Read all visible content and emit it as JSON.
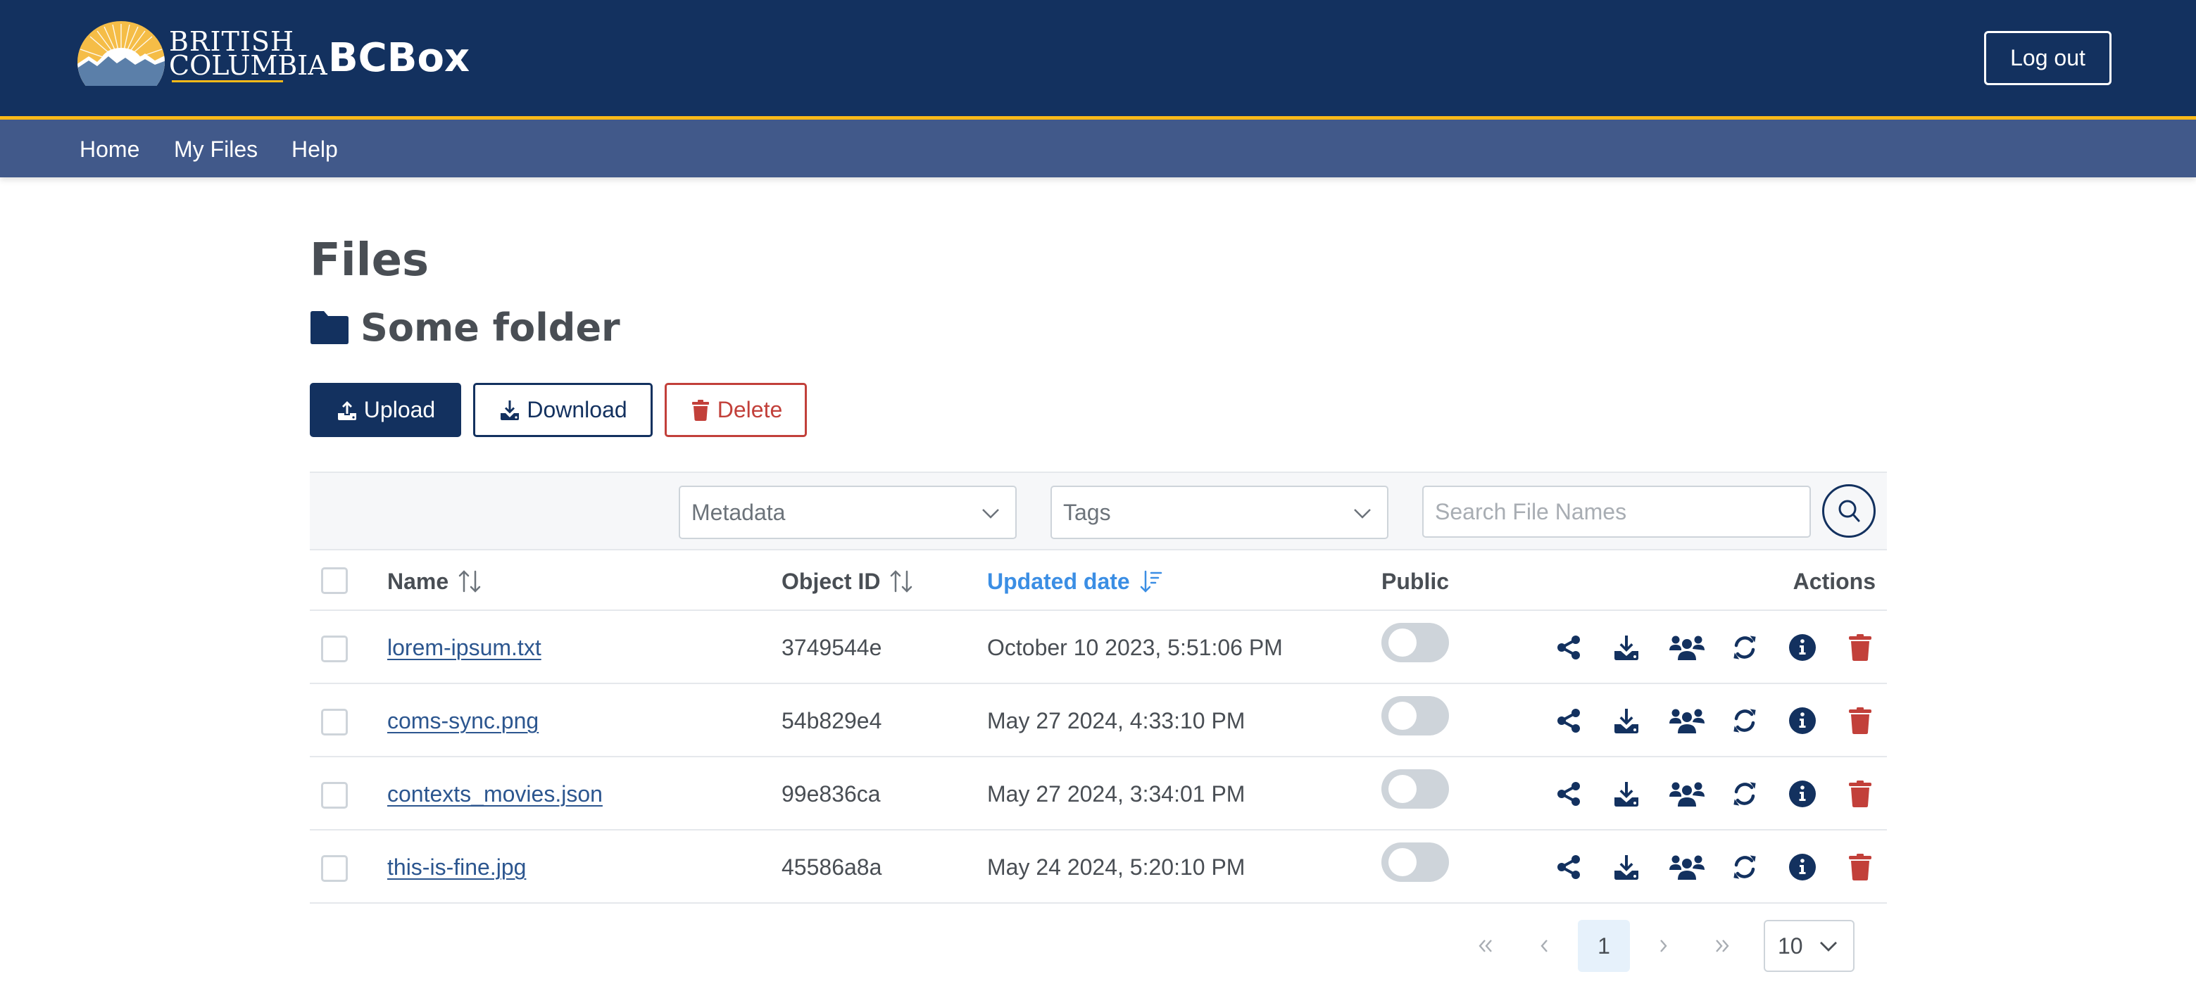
{
  "header": {
    "logo_line1": "BRITISH",
    "logo_line2": "COLUMBIA",
    "app_title": "BCBox",
    "logout_label": "Log out",
    "colors": {
      "header_bg": "#13315f",
      "stripe": "#fcba19",
      "nav_bg": "#41598a"
    }
  },
  "nav": {
    "items": [
      {
        "label": "Home"
      },
      {
        "label": "My Files"
      },
      {
        "label": "Help"
      }
    ]
  },
  "page": {
    "title": "Files",
    "folder_icon": "folder-icon",
    "folder_name": "Some folder"
  },
  "toolbar": {
    "upload_label": "Upload",
    "download_label": "Download",
    "delete_label": "Delete"
  },
  "filters": {
    "metadata_label": "Metadata",
    "tags_label": "Tags",
    "search_placeholder": "Search File Names",
    "search_icon": "search-icon"
  },
  "table": {
    "columns": {
      "name": "Name",
      "object_id": "Object ID",
      "updated_date": "Updated date",
      "public": "Public",
      "actions": "Actions"
    },
    "sorted_column": "updated_date",
    "sort_direction": "descending",
    "action_icons": [
      "share-icon",
      "download-icon",
      "users-icon",
      "sync-icon",
      "info-icon",
      "trash-icon"
    ],
    "rows": [
      {
        "name": "lorem-ipsum.txt",
        "object_id": "3749544e",
        "updated_date": "October 10 2023, 5:51:06 PM",
        "public": false
      },
      {
        "name": "coms-sync.png",
        "object_id": "54b829e4",
        "updated_date": "May 27 2024, 4:33:10 PM",
        "public": false
      },
      {
        "name": "contexts_movies.json",
        "object_id": "99e836ca",
        "updated_date": "May 27 2024, 3:34:01 PM",
        "public": false
      },
      {
        "name": "this-is-fine.jpg",
        "object_id": "45586a8a",
        "updated_date": "May 24 2024, 5:20:10 PM",
        "public": false
      }
    ]
  },
  "pagination": {
    "current_page": "1",
    "rows_per_page": "10"
  },
  "colors": {
    "primary": "#13315f",
    "danger": "#c2403a",
    "link": "#2c568f",
    "active_sort": "#3b8ee4"
  }
}
